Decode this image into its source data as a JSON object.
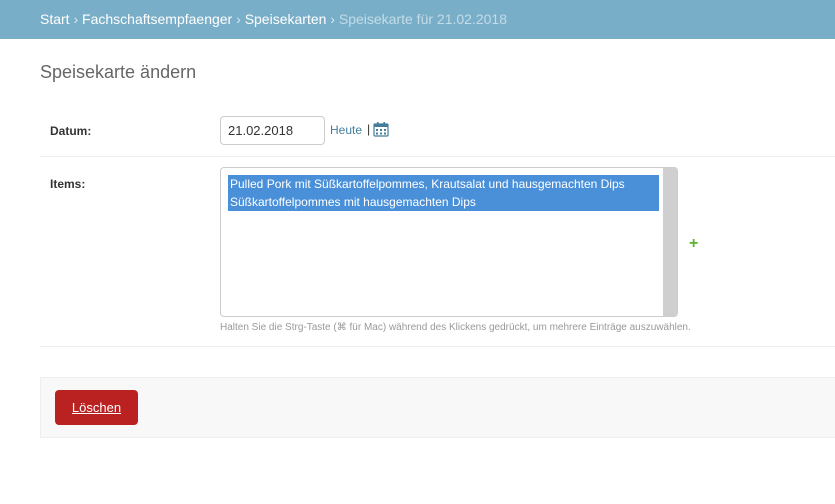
{
  "breadcrumbs": {
    "items": [
      "Start",
      "Fachschaftsempfaenger",
      "Speisekarten"
    ],
    "current": "Speisekarte für 21.02.2018",
    "separator": "›"
  },
  "page_title": "Speisekarte ändern",
  "datum": {
    "label": "Datum:",
    "value": "21.02.2018",
    "today_link": "Heute",
    "separator": "|",
    "calendar_icon": "calendar-icon"
  },
  "items": {
    "label": "Items:",
    "options": [
      "Pulled Pork mit Süßkartoffelpommes, Krautsalat und hausgemachten Dips",
      "Süßkartoffelpommes mit hausgemachten Dips"
    ],
    "add_icon": "plus-icon",
    "add_symbol": "+",
    "help": "Halten Sie die Strg-Taste (⌘ für Mac) während des Klickens gedrückt, um mehrere Einträge auszuwählen."
  },
  "submit": {
    "delete_label": "Löschen"
  },
  "colors": {
    "header": "#79aec8",
    "link": "#447e9b",
    "selected_option": "#4a90d9",
    "delete_button": "#ba2121",
    "add_icon": "#5bb32d"
  }
}
